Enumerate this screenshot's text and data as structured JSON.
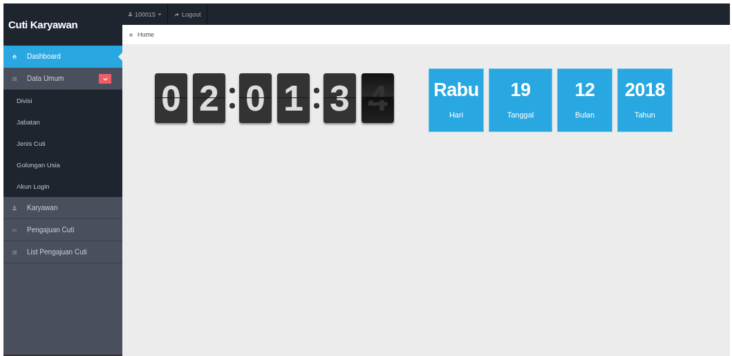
{
  "sidebar": {
    "title": "Cuti Karyawan",
    "items": [
      {
        "label": "Dashboard",
        "selected": true
      },
      {
        "label": "Data Umum",
        "selected": false,
        "expanded": true,
        "children": [
          {
            "label": "Divisi"
          },
          {
            "label": "Jabatan"
          },
          {
            "label": "Jenis Cuti"
          },
          {
            "label": "Golongan Usia"
          },
          {
            "label": "Akun Login"
          }
        ]
      },
      {
        "label": "Karyawan",
        "selected": false
      },
      {
        "label": "Pengajuan Cuti",
        "selected": false
      },
      {
        "label": "List Pengajuan Cuti",
        "selected": false
      }
    ]
  },
  "topbar": {
    "user": "100015",
    "logout": "Logout"
  },
  "breadcrumb": "Home",
  "clock": [
    {
      "digits": [
        {
          "d": "0",
          "flipping": false
        },
        {
          "d": "2",
          "flipping": false
        }
      ]
    },
    {
      "digits": [
        {
          "d": "0",
          "flipping": false
        },
        {
          "d": "1",
          "flipping": false
        }
      ]
    },
    {
      "digits": [
        {
          "d": "3",
          "flipping": false
        },
        {
          "d": "4",
          "flipping": true
        }
      ]
    }
  ],
  "date": [
    {
      "value": "Rabu",
      "label": "Hari"
    },
    {
      "value": "19",
      "label": "Tanggal"
    },
    {
      "value": "12",
      "label": "Bulan"
    },
    {
      "value": "2018",
      "label": "Tahun"
    }
  ]
}
